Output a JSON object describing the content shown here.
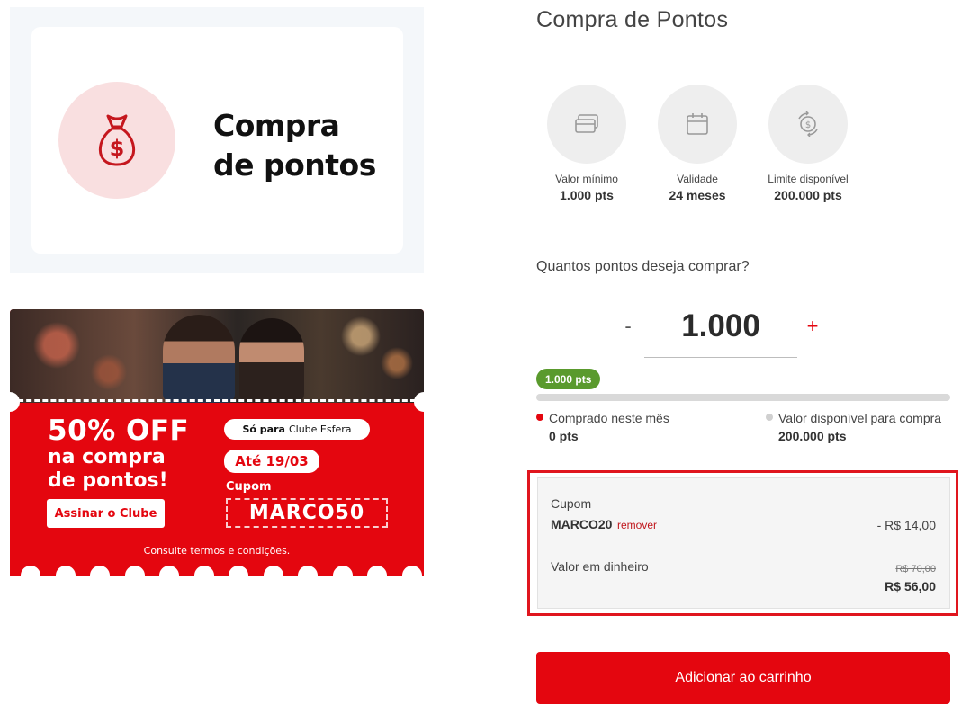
{
  "product_card": {
    "title_line1": "Compra",
    "title_line2": "de pontos",
    "icon": "money-bag-icon"
  },
  "promo_banner": {
    "headline": "50% OFF",
    "subline1": "na compra",
    "subline2": "de pontos!",
    "club_prefix": "Só para",
    "club_name": "Clube Esfera",
    "date": "Até 19/03",
    "coupon_label": "Cupom",
    "coupon_code": "MARCO50",
    "subscribe_label": "Assinar o Clube",
    "terms": "Consulte termos e condições."
  },
  "page_title": "Compra de Pontos",
  "info": [
    {
      "icon": "credit-card-icon",
      "label": "Valor mínimo",
      "value": "1.000 pts"
    },
    {
      "icon": "calendar-icon",
      "label": "Validade",
      "value": "24 meses"
    },
    {
      "icon": "currency-exchange-icon",
      "label": "Limite disponível",
      "value": "200.000 pts"
    }
  ],
  "quantity": {
    "question": "Quantos pontos deseja comprar?",
    "minus": "-",
    "value": "1.000",
    "plus": "+"
  },
  "progress": {
    "badge": "1.000 pts",
    "fraction": 0,
    "purchased_label": "Comprado neste mês",
    "purchased_value": "0 pts",
    "available_label": "Valor disponível para compra",
    "available_value": "200.000 pts"
  },
  "summary": {
    "coupon_label": "Cupom",
    "coupon_code": "MARCO20",
    "remove_label": "remover",
    "coupon_discount": "- R$ 14,00",
    "cash_label": "Valor em dinheiro",
    "cash_old": "R$ 70,00",
    "cash_new": "R$ 56,00"
  },
  "cart_button": "Adicionar ao carrinho",
  "colors": {
    "accent": "#e4060f",
    "badge_green": "#5a9a2d",
    "highlight_border": "#e0161e"
  }
}
